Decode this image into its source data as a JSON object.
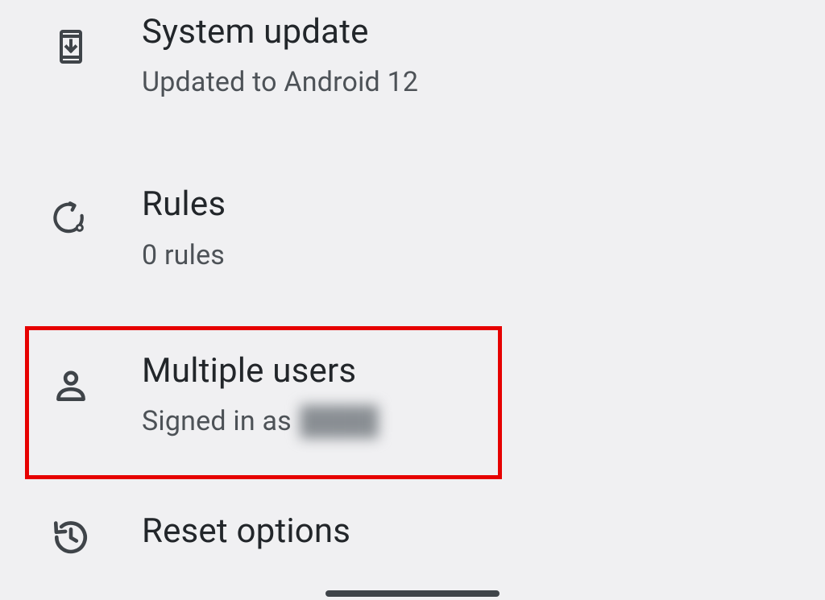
{
  "settings": [
    {
      "title": "System update",
      "subtitle": "Updated to Android 12"
    },
    {
      "title": "Rules",
      "subtitle": "0 rules"
    },
    {
      "title": "Multiple users",
      "subtitle_prefix": "Signed in as ",
      "subtitle_redacted": "████"
    },
    {
      "title": "Reset options"
    }
  ]
}
